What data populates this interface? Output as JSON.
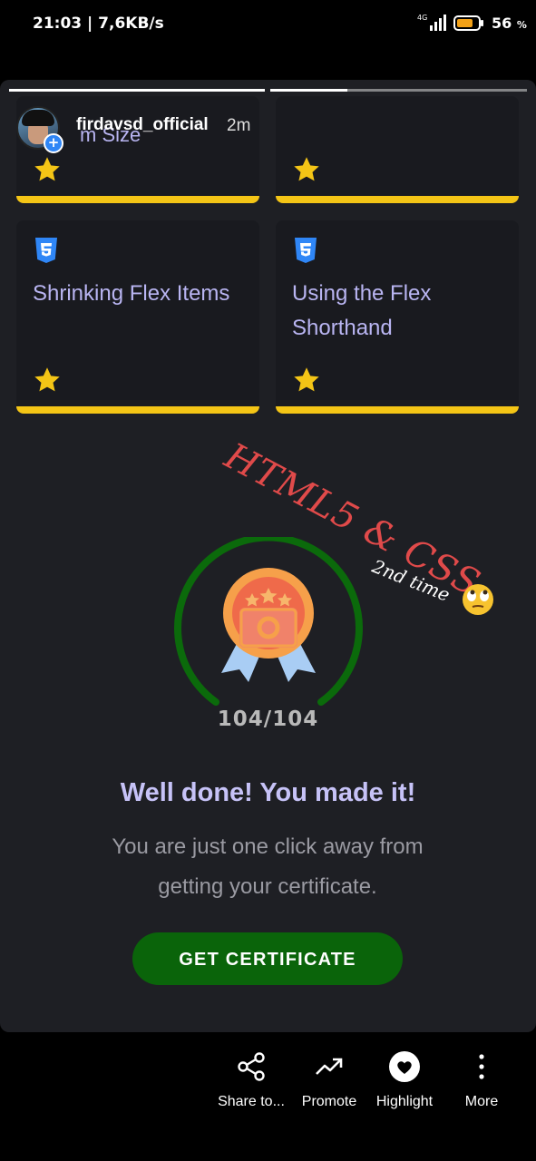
{
  "status_bar": {
    "time_speed": "21:03 | 7,6KB/s",
    "network": "4G",
    "battery": "56",
    "battery_unit": "%"
  },
  "story": {
    "username": "firdavsd_official",
    "time_ago": "2m",
    "hidden_card_title_fragment": "m Size",
    "cards": [
      {
        "title": "Shrinking Flex Items"
      },
      {
        "title": "Using the Flex Shorthand"
      }
    ],
    "sticker_text": "HTML5 & CSS",
    "sticker_subtext": "2nd time",
    "progress_count": "104/104",
    "progress_fraction": 1.0,
    "headline": "Well done! You made it!",
    "subtext": "You are just one click away from getting your certificate.",
    "cta_label": "GET CERTIFICATE",
    "colors": {
      "accent_text": "#c6c2f7",
      "card_bar": "#f4c516",
      "cta_bg": "#0a640a",
      "sticker": "#e04a4a",
      "progress_ring": "#0b6a0b"
    }
  },
  "bottom_actions": [
    {
      "label": "Share to...",
      "icon": "share-icon"
    },
    {
      "label": "Promote",
      "icon": "trend-up-icon"
    },
    {
      "label": "Highlight",
      "icon": "heart-circle-icon"
    },
    {
      "label": "More",
      "icon": "more-vertical-icon"
    }
  ]
}
